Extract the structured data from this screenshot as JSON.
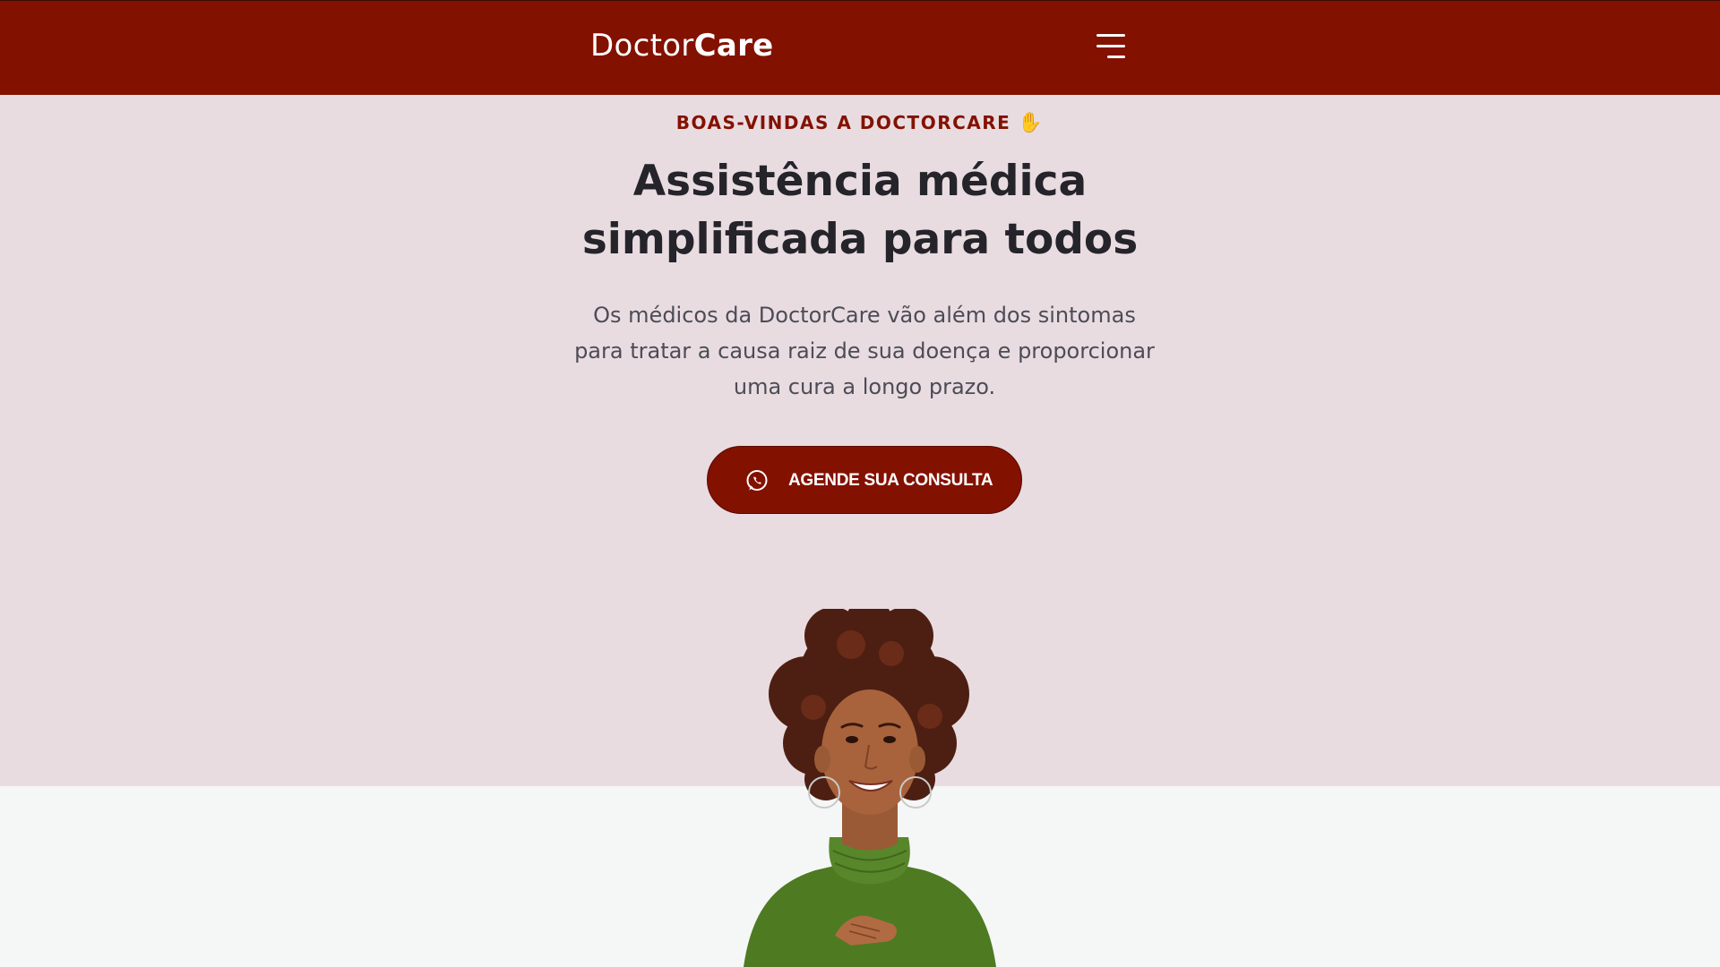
{
  "header": {
    "logo_regular": "Doctor",
    "logo_bold": "Care",
    "menu_icon": "hamburger-menu-icon"
  },
  "hero": {
    "eyebrow": "BOAS-VINDAS A DOCTORCARE",
    "eyebrow_icon": "waving-hand-emoji",
    "title_line1": "Assistência médica",
    "title_line2": "simplificada para todos",
    "subtitle_line1": "Os médicos da DoctorCare vão além dos sintomas",
    "subtitle_line2": "para tratar a causa raiz de sua doença e proporcionar",
    "subtitle_line3": "uma cura a longo prazo.",
    "cta_label": "AGENDE SUA CONSULTA",
    "cta_icon": "whatsapp-icon",
    "image": "smiling-woman-portrait"
  },
  "colors": {
    "brand": "#831100",
    "hero_bg": "#e9dce1",
    "page_bg": "#f5f6f6",
    "heading": "#24242a",
    "body_text": "#4c4c56"
  }
}
